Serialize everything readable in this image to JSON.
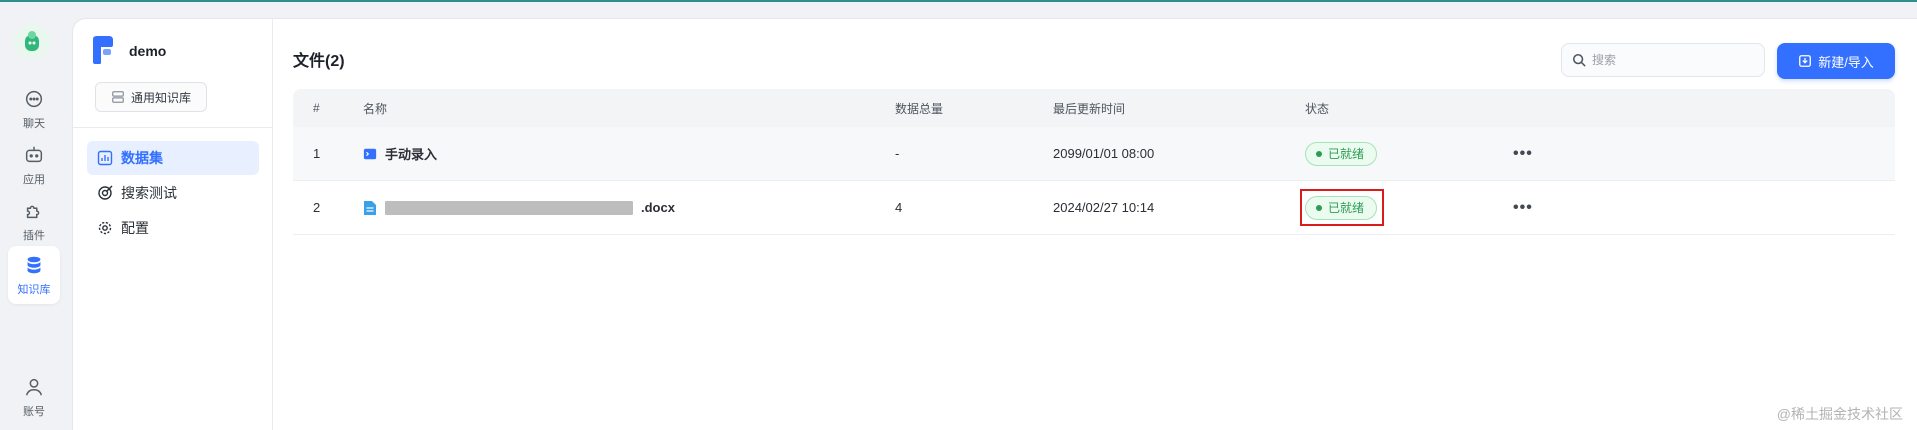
{
  "rail": {
    "items": [
      {
        "label": "聊天",
        "icon": "chat-icon"
      },
      {
        "label": "应用",
        "icon": "robot-icon"
      },
      {
        "label": "插件",
        "icon": "puzzle-icon"
      },
      {
        "label": "知识库",
        "icon": "database-icon",
        "active": true
      },
      {
        "label": "账号",
        "icon": "user-icon"
      }
    ]
  },
  "kb": {
    "name": "demo",
    "type_label": "通用知识库",
    "nav": [
      {
        "label": "数据集",
        "icon": "chart-icon",
        "active": true
      },
      {
        "label": "搜索测试",
        "icon": "target-icon"
      },
      {
        "label": "配置",
        "icon": "gear-icon"
      }
    ]
  },
  "main": {
    "title": "文件(2)",
    "search_placeholder": "搜索",
    "new_button": "新建/导入"
  },
  "table": {
    "headers": [
      "#",
      "名称",
      "数据总量",
      "最后更新时间",
      "状态"
    ],
    "rows": [
      {
        "index": "1",
        "name": "手动录入",
        "icon": "manual-entry-icon",
        "total": "-",
        "updated": "2099/01/01 08:00",
        "status": "已就绪",
        "more": "•••"
      },
      {
        "index": "2",
        "name": ".docx",
        "icon": "docx-file-icon",
        "total": "4",
        "updated": "2024/02/27 10:14",
        "status": "已就绪",
        "more": "•••"
      }
    ]
  },
  "watermark": "@稀土掘金技术社区",
  "colors": {
    "accent": "#3370ff",
    "status_green": "#2b9d52",
    "highlight_red": "#d91c1c"
  }
}
